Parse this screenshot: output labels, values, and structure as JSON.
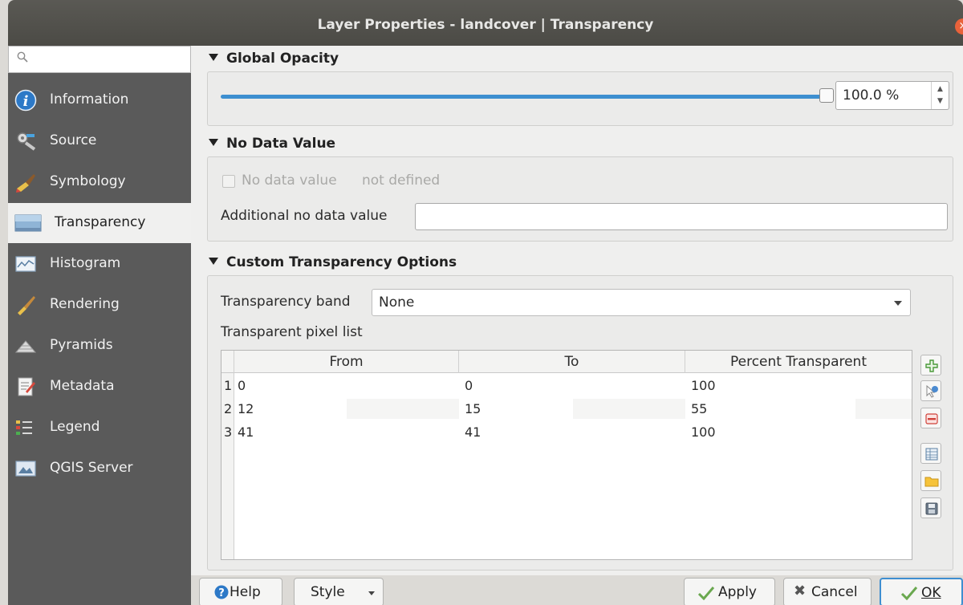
{
  "window": {
    "title": "Layer Properties - landcover | Transparency",
    "close_glyph": "×"
  },
  "search": {
    "placeholder": ""
  },
  "sidebar": {
    "items": [
      {
        "label": "Information",
        "icon": "info-icon"
      },
      {
        "label": "Source",
        "icon": "source-icon"
      },
      {
        "label": "Symbology",
        "icon": "symbology-icon"
      },
      {
        "label": "Transparency",
        "icon": "transparency-icon",
        "active": true
      },
      {
        "label": "Histogram",
        "icon": "histogram-icon"
      },
      {
        "label": "Rendering",
        "icon": "rendering-icon"
      },
      {
        "label": "Pyramids",
        "icon": "pyramids-icon"
      },
      {
        "label": "Metadata",
        "icon": "metadata-icon"
      },
      {
        "label": "Legend",
        "icon": "legend-icon"
      },
      {
        "label": "QGIS Server",
        "icon": "qgis-server-icon"
      }
    ]
  },
  "global_opacity": {
    "title": "Global Opacity",
    "value_text": "100.0 %",
    "value": 1.0
  },
  "no_data": {
    "title": "No Data Value",
    "checkbox_label": "No data value",
    "checkbox_status": "not defined",
    "additional_label": "Additional no data value",
    "additional_value": ""
  },
  "custom": {
    "title": "Custom Transparency Options",
    "band_label": "Transparency band",
    "band_value": "None",
    "pixel_list_label": "Transparent pixel list",
    "columns": [
      "From",
      "To",
      "Percent Transparent"
    ],
    "rows": [
      {
        "num": "1",
        "from": "0",
        "to": "0",
        "percent": "100"
      },
      {
        "num": "2",
        "from": "12",
        "to": "15",
        "percent": "55"
      },
      {
        "num": "3",
        "from": "41",
        "to": "41",
        "percent": "100"
      }
    ]
  },
  "buttons": {
    "help": "Help",
    "style": "Style",
    "apply": "Apply",
    "cancel": "Cancel",
    "ok": "OK"
  },
  "colors": {
    "accent": "#3d8fd0",
    "sidebar": "#5a5a5a",
    "titlebar": "#4f4e49",
    "close": "#e9623a"
  }
}
